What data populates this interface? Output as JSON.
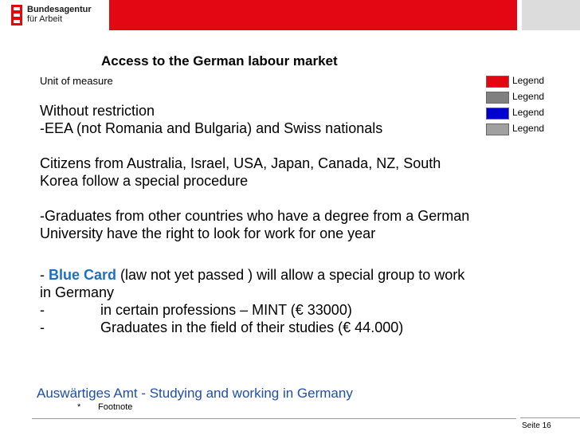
{
  "header": {
    "org_line1": "Bundesagentur",
    "org_line2": "für Arbeit",
    "brand_color": "#e30613"
  },
  "slide": {
    "title": "Access to the German labour market",
    "unit_of_measure": "Unit of measure",
    "legend": [
      {
        "label": "Legend",
        "color": "#e30613"
      },
      {
        "label": "Legend",
        "color": "#808080"
      },
      {
        "label": "Legend",
        "color": "#0000cc"
      },
      {
        "label": "Legend",
        "color": "#a0a0a0"
      }
    ],
    "body": {
      "line1": "Without restriction",
      "line2": "-EEA (not Romania and Bulgaria) and Swiss nationals",
      "line3": "Citizens from Australia, Israel, USA, Japan, Canada, NZ, South",
      "line4": "Korea follow a special procedure",
      "line5": "-Graduates from other countries who have a degree from a German",
      "line6": "University have the right to look for work for one year",
      "bluecard_dash": "- ",
      "bluecard_label": "Blue Card",
      "bluecard_rest": " (law not yet passed ) will allow a special group to work",
      "line8": "in Germany",
      "bullet1_dash": "-",
      "bullet1": "in  certain professions – MINT (€ 33000)",
      "bullet2_dash": "-",
      "bullet2": "Graduates in the field of their studies (€ 44.000)"
    },
    "source_link": "Auswärtiges Amt - Studying and working in Germany",
    "footnote_star": "*",
    "footnote": "Footnote",
    "page_label": "Seite 16"
  }
}
